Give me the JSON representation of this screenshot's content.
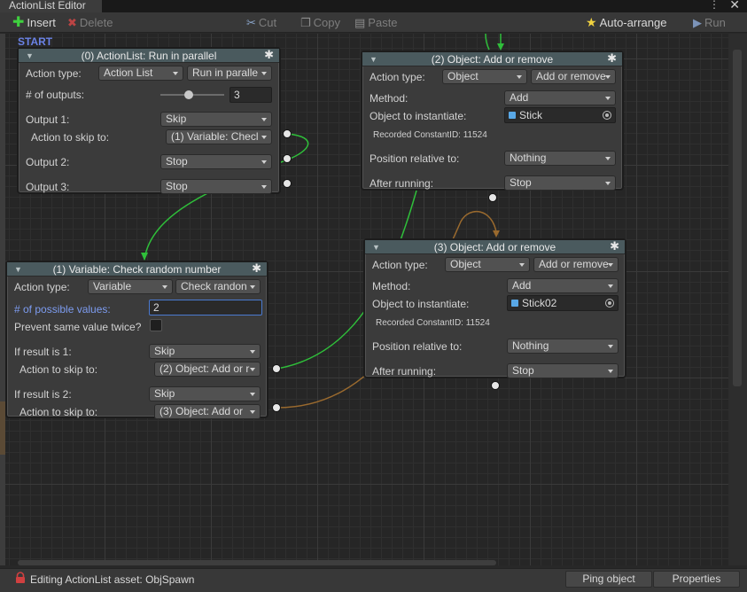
{
  "window": {
    "tab_title": "ActionList Editor",
    "more": "⋮",
    "close": "✕"
  },
  "toolbar": {
    "insert": "Insert",
    "delete": "Delete",
    "cut": "Cut",
    "copy": "Copy",
    "paste": "Paste",
    "auto_arrange": "Auto-arrange",
    "run": "Run"
  },
  "canvas": {
    "start_label": "START"
  },
  "nodes": {
    "n0": {
      "title": "(0) ActionList: Run in parallel",
      "action_type_label": "Action type:",
      "action_type_value": "Action List",
      "action_subtype_value": "Run in paralle",
      "outputs_label": "# of outputs:",
      "outputs_value": "3",
      "outputs_slider_fraction": 0.45,
      "output1_label": "Output 1:",
      "output1_value": "Skip",
      "skip_to_label": "Action to skip to:",
      "skip_to_value": "(1) Variable: Checl",
      "output2_label": "Output 2:",
      "output2_value": "Stop",
      "output3_label": "Output 3:",
      "output3_value": "Stop"
    },
    "n1": {
      "title": "(1) Variable: Check random number",
      "action_type_label": "Action type:",
      "action_type_value": "Variable",
      "action_subtype_value": "Check randon",
      "possible_label": "# of possible values:",
      "possible_value": "2",
      "prevent_label": "Prevent same value twice?",
      "result1_label": "If result is 1:",
      "result1_value": "Skip",
      "skip1_label": "Action to skip to:",
      "skip1_value": "(2) Object: Add or r",
      "result2_label": "If result is 2:",
      "result2_value": "Skip",
      "skip2_label": "Action to skip to:",
      "skip2_value": "(3) Object: Add or"
    },
    "n2": {
      "title": "(2) Object: Add or remove",
      "action_type_label": "Action type:",
      "action_type_value": "Object",
      "action_subtype_value": "Add or remove",
      "method_label": "Method:",
      "method_value": "Add",
      "object_label": "Object to instantiate:",
      "object_value": "Stick",
      "constant_id": "Recorded ConstantID: 11524",
      "position_label": "Position relative to:",
      "position_value": "Nothing",
      "after_label": "After running:",
      "after_value": "Stop"
    },
    "n3": {
      "title": "(3) Object: Add or remove",
      "action_type_label": "Action type:",
      "action_type_value": "Object",
      "action_subtype_value": "Add or remove",
      "method_label": "Method:",
      "method_value": "Add",
      "object_label": "Object to instantiate:",
      "object_value": "Stick02",
      "constant_id": "Recorded ConstantID: 11524",
      "position_label": "Position relative to:",
      "position_value": "Nothing",
      "after_label": "After running:",
      "after_value": "Stop"
    }
  },
  "statusbar": {
    "message": "Editing ActionList asset: ObjSpawn",
    "ping_object": "Ping object",
    "properties": "Properties"
  },
  "colors": {
    "accent_blue": "#6a82e6",
    "wire_green": "#2fbf3a",
    "wire_brown": "#9a6a2e",
    "header": "#4a5a5e"
  }
}
